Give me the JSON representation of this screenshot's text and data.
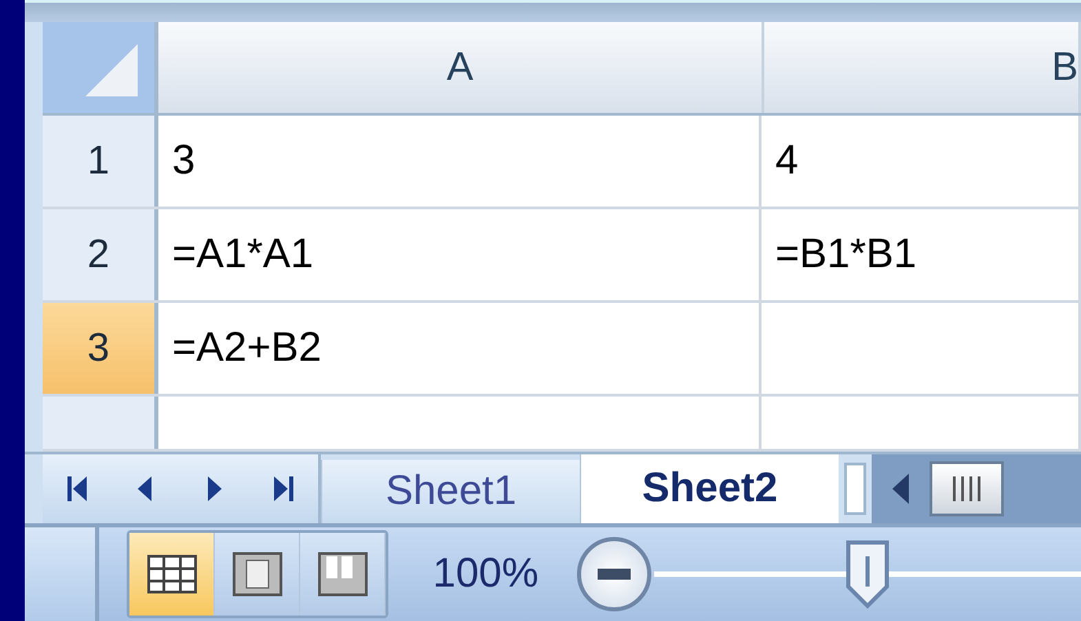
{
  "columns": [
    "A",
    "B"
  ],
  "rows": [
    {
      "label": "1",
      "selected": false,
      "cells": [
        "3",
        "4"
      ]
    },
    {
      "label": "2",
      "selected": false,
      "cells": [
        "=A1*A1",
        "=B1*B1"
      ]
    },
    {
      "label": "3",
      "selected": true,
      "cells": [
        "=A2+B2"
      ]
    }
  ],
  "sheet_tabs": [
    {
      "label": "Sheet1",
      "selected": false
    },
    {
      "label": "Sheet2",
      "selected": true
    }
  ],
  "status_bar": {
    "views": [
      {
        "kind": "normal",
        "selected": true
      },
      {
        "kind": "page-layout",
        "selected": false
      },
      {
        "kind": "page-break",
        "selected": false
      }
    ],
    "zoom": "100%",
    "zoom_slider": {
      "level": 0.5
    }
  }
}
